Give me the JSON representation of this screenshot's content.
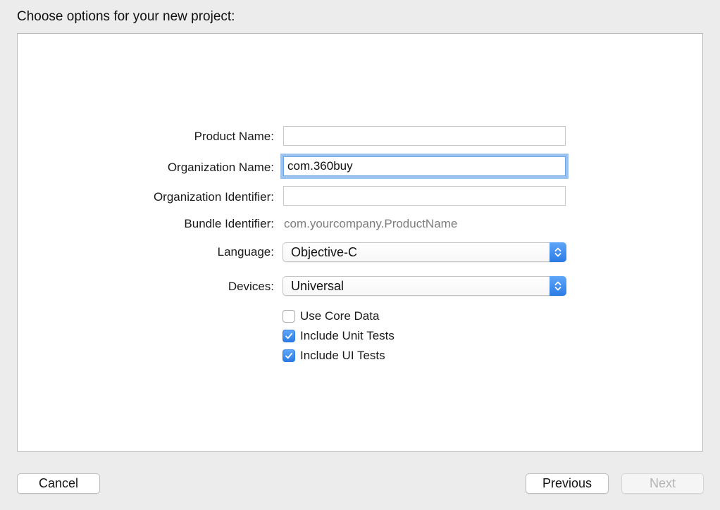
{
  "dialog": {
    "title": "Choose options for your new project:"
  },
  "form": {
    "product_name": {
      "label": "Product Name:",
      "value": ""
    },
    "organization_name": {
      "label": "Organization Name:",
      "value": "com.360buy"
    },
    "organization_identifier": {
      "label": "Organization Identifier:",
      "value": ""
    },
    "bundle_identifier": {
      "label": "Bundle Identifier:",
      "value": "com.yourcompany.ProductName"
    },
    "language": {
      "label": "Language:",
      "value": "Objective-C"
    },
    "devices": {
      "label": "Devices:",
      "value": "Universal"
    },
    "checkboxes": [
      {
        "label": "Use Core Data",
        "checked": false
      },
      {
        "label": "Include Unit Tests",
        "checked": true
      },
      {
        "label": "Include UI Tests",
        "checked": true
      }
    ]
  },
  "buttons": {
    "cancel": "Cancel",
    "previous": "Previous",
    "next": "Next"
  },
  "colors": {
    "accent": "#2c7be5",
    "focus_ring": "#9cc3ef",
    "window_background": "#ececec",
    "disabled_text": "#b4b4b4"
  },
  "icons": {
    "popup_arrows": "up-down-chevron-icon",
    "checkmark": "checkmark-icon"
  }
}
